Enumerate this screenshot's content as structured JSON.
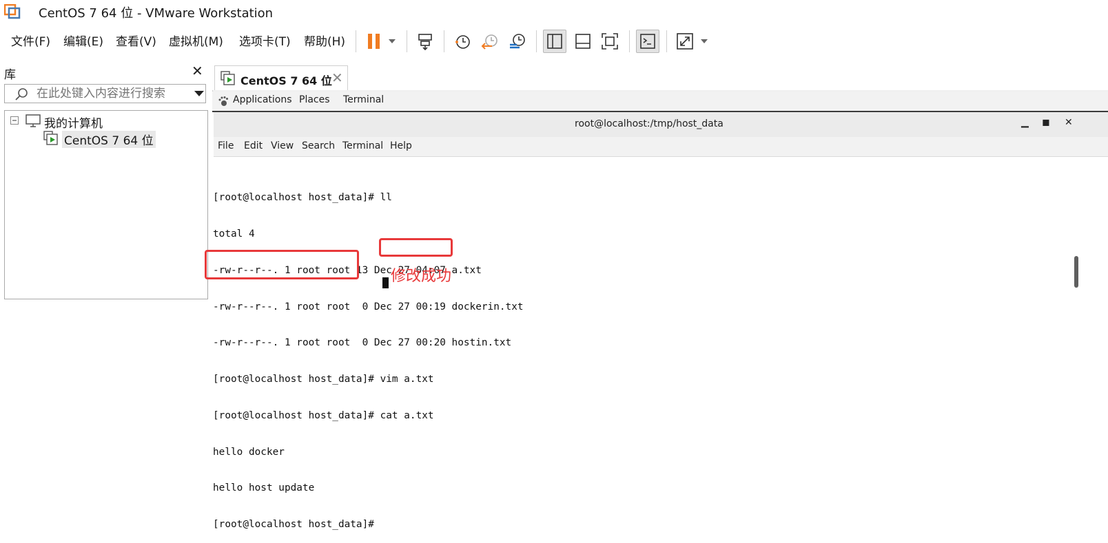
{
  "window": {
    "title": "CentOS 7 64 位 - VMware Workstation"
  },
  "menu": [
    "文件(F)",
    "编辑(E)",
    "查看(V)",
    "虚拟机(M)",
    "选项卡(T)",
    "帮助(H)"
  ],
  "toolbar_icons": [
    "pause-icon",
    "dropdown-icon",
    "send-ctrl-alt-del-icon",
    "snapshot-icon",
    "revert-snapshot-icon",
    "manage-snapshots-icon",
    "library-view-icon",
    "thumbnail-view-icon",
    "fullscreen-icon",
    "console-view-icon",
    "stretch-icon",
    "dropdown-icon"
  ],
  "library": {
    "title": "库",
    "search_placeholder": "在此处键入内容进行搜索",
    "tree": {
      "root": "我的计算机",
      "child": "CentOS 7 64 位"
    }
  },
  "tab": {
    "label": "CentOS 7 64 位"
  },
  "gnome_bar": [
    "Applications",
    "Places",
    "Terminal"
  ],
  "terminal": {
    "title": "root@localhost:/tmp/host_data",
    "menu": [
      "File",
      "Edit",
      "View",
      "Search",
      "Terminal",
      "Help"
    ],
    "lines": [
      "[root@localhost host_data]# ll",
      "total 4",
      "-rw-r--r--. 1 root root 13 Dec 27 04:07 a.txt",
      "-rw-r--r--. 1 root root  0 Dec 27 00:19 dockerin.txt",
      "-rw-r--r--. 1 root root  0 Dec 27 00:20 hostin.txt",
      "[root@localhost host_data]# vim a.txt",
      "[root@localhost host_data]# cat a.txt",
      "hello docker",
      "hello host update",
      "[root@localhost host_data]# "
    ]
  },
  "annotation": {
    "text": "修改成功",
    "color": "#e8393a"
  },
  "colors": {
    "accent_orange": "#f07c22",
    "annotation_red": "#e8393a"
  }
}
